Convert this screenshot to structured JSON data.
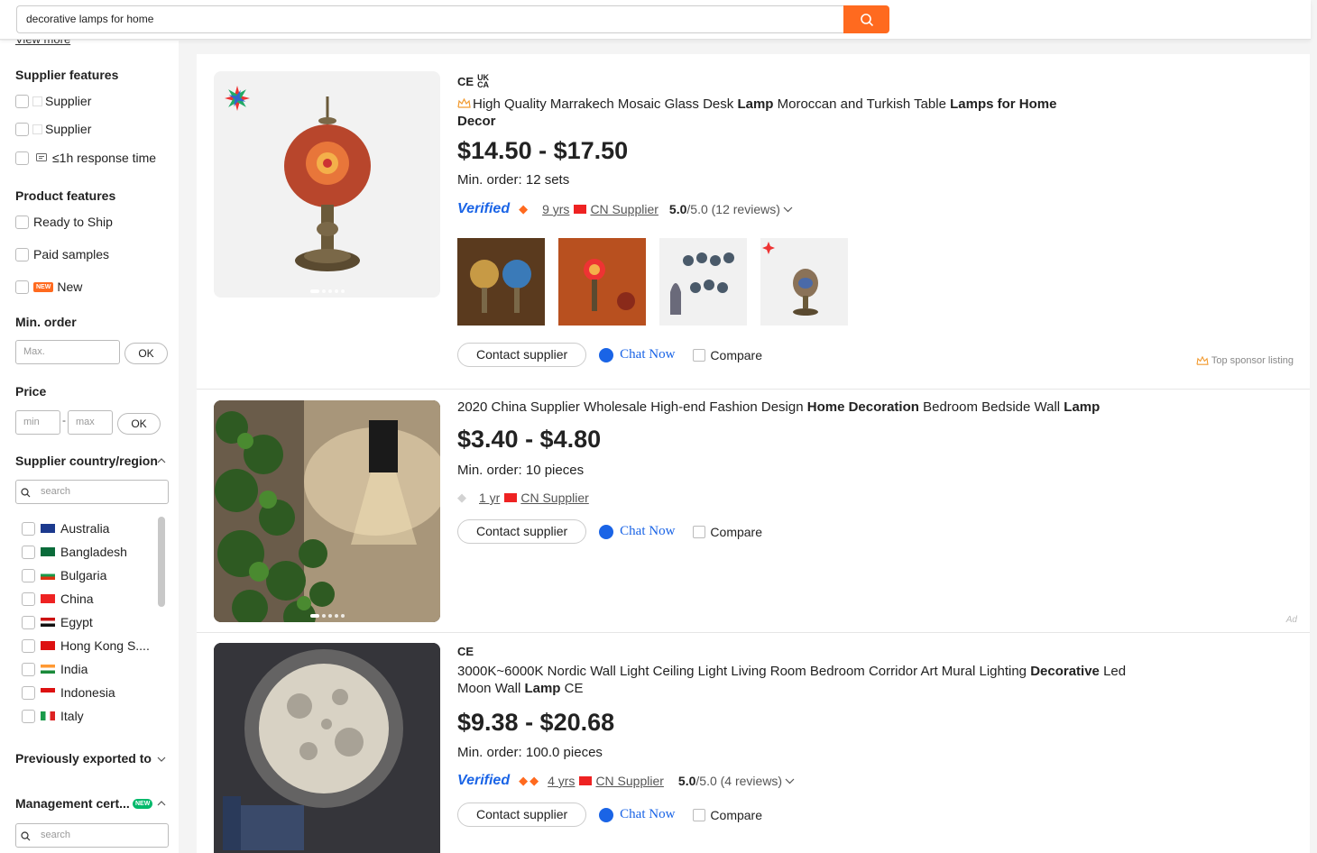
{
  "search": {
    "value": "decorative lamps for home"
  },
  "sidebar": {
    "view_more": "View more",
    "supplier_features": {
      "title": "Supplier features",
      "items": [
        "Supplier",
        "Supplier",
        "≤1h response time"
      ]
    },
    "product_features": {
      "title": "Product features",
      "items": [
        "Ready to Ship",
        "Paid samples",
        "New"
      ],
      "new_badge": "NEW"
    },
    "min_order": {
      "title": "Min. order",
      "placeholder": "Max.",
      "ok": "OK"
    },
    "price": {
      "title": "Price",
      "min_placeholder": "min",
      "max_placeholder": "max",
      "ok": "OK"
    },
    "country": {
      "title": "Supplier country/region",
      "search_placeholder": "search",
      "items": [
        "Australia",
        "Bangladesh",
        "Bulgaria",
        "China",
        "Egypt",
        "Hong Kong S....",
        "India",
        "Indonesia",
        "Italy"
      ]
    },
    "previously_exported": {
      "title": "Previously exported to"
    },
    "management_cert": {
      "title": "Management cert...",
      "badge": "NEW",
      "search_placeholder": "search"
    }
  },
  "listings": [
    {
      "certs": [
        "CE",
        "UK CA"
      ],
      "title_parts": [
        {
          "text": "High Quality Marrakech Mosaic Glass Desk ",
          "bold": false
        },
        {
          "text": "Lamp",
          "bold": true
        },
        {
          "text": " Moroccan and Turkish Table ",
          "bold": false
        },
        {
          "text": "Lamps for Home",
          "bold": true
        },
        {
          "text": " ",
          "bold": false
        },
        {
          "text": "Decor",
          "bold": true
        }
      ],
      "price": "$14.50 - $17.50",
      "moq": "Min. order: 12 sets",
      "verified": "Verified",
      "years": "9 yrs",
      "supplier": "CN Supplier",
      "rating": "5.0",
      "rating_rest": "/5.0 (12 reviews)",
      "contact": "Contact supplier",
      "chat": "Chat Now",
      "compare": "Compare",
      "sponsor": "Top sponsor listing"
    },
    {
      "title_parts": [
        {
          "text": "2020 China Supplier Wholesale High-end Fashion Design ",
          "bold": false
        },
        {
          "text": "Home Decoration",
          "bold": true
        },
        {
          "text": " Bedroom Bedside Wall ",
          "bold": false
        },
        {
          "text": "Lamp",
          "bold": true
        }
      ],
      "price": "$3.40 - $4.80",
      "moq": "Min. order: 10 pieces",
      "years": "1 yr",
      "supplier": "CN Supplier",
      "contact": "Contact supplier",
      "chat": "Chat Now",
      "compare": "Compare",
      "ad": "Ad"
    },
    {
      "certs": [
        "CE"
      ],
      "title_parts": [
        {
          "text": "3000K~6000K Nordic Wall Light Ceiling Light Living Room Bedroom Corridor Art Mural Lighting ",
          "bold": false
        },
        {
          "text": "Decorative",
          "bold": true
        },
        {
          "text": " Led Moon Wall ",
          "bold": false
        },
        {
          "text": "Lamp",
          "bold": true
        },
        {
          "text": " CE",
          "bold": false
        }
      ],
      "price": "$9.38 - $20.68",
      "moq": "Min. order: 100.0 pieces",
      "verified": "Verified",
      "years": "4 yrs",
      "supplier": "CN Supplier",
      "rating": "5.0",
      "rating_rest": "/5.0 (4 reviews)",
      "contact": "Contact supplier",
      "chat": "Chat Now",
      "compare": "Compare"
    }
  ],
  "colors": {
    "accent": "#ff6a1f",
    "verified_blue": "#1a64e6"
  }
}
